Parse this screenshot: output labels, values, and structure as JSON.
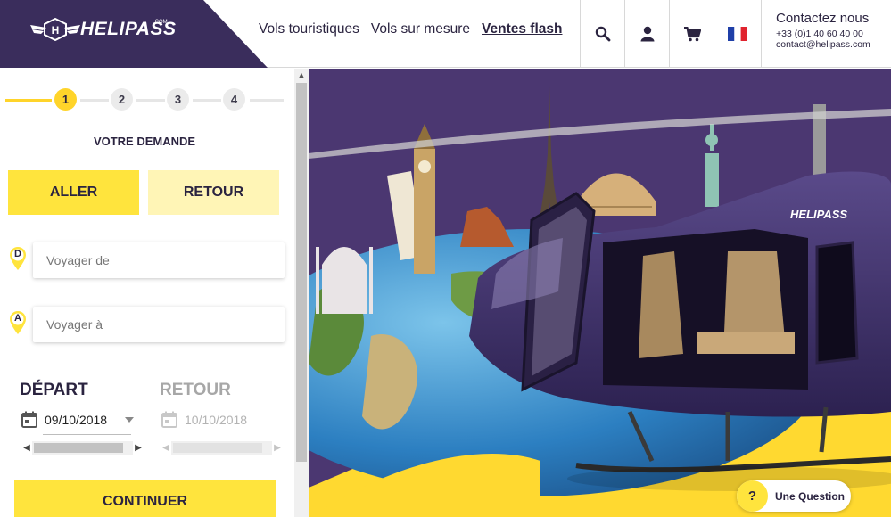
{
  "brand": {
    "name": "HELIPASS",
    "suffix": ".COM"
  },
  "nav": {
    "items": [
      "Vols touristiques",
      "Vols sur mesure"
    ],
    "flash": "Ventes flash"
  },
  "header_icons": [
    "search-icon",
    "user-icon",
    "cart-icon",
    "french-flag-icon"
  ],
  "contact": {
    "title": "Contactez nous",
    "phone": "+33 (0)1 40 60 40 00",
    "email": "contact@helipass.com"
  },
  "steps": [
    "1",
    "2",
    "3",
    "4"
  ],
  "form": {
    "title": "VOTRE DEMANDE",
    "tab_aller": "ALLER",
    "tab_retour": "RETOUR",
    "from_letter": "D",
    "to_letter": "A",
    "from_placeholder": "Voyager de",
    "to_placeholder": "Voyager à",
    "depart_label": "DÉPART",
    "retour_label": "RETOUR",
    "depart_date": "09/10/2018",
    "retour_date": "10/10/2018",
    "continue": "CONTINUER"
  },
  "hero": {
    "helicopter_brand": "HELIPASS"
  },
  "help": {
    "icon": "?",
    "label": "Une Question"
  },
  "colors": {
    "brand_purple": "#3a2d5c",
    "accent_yellow": "#ffe43d",
    "light_yellow": "#fff5b6"
  }
}
